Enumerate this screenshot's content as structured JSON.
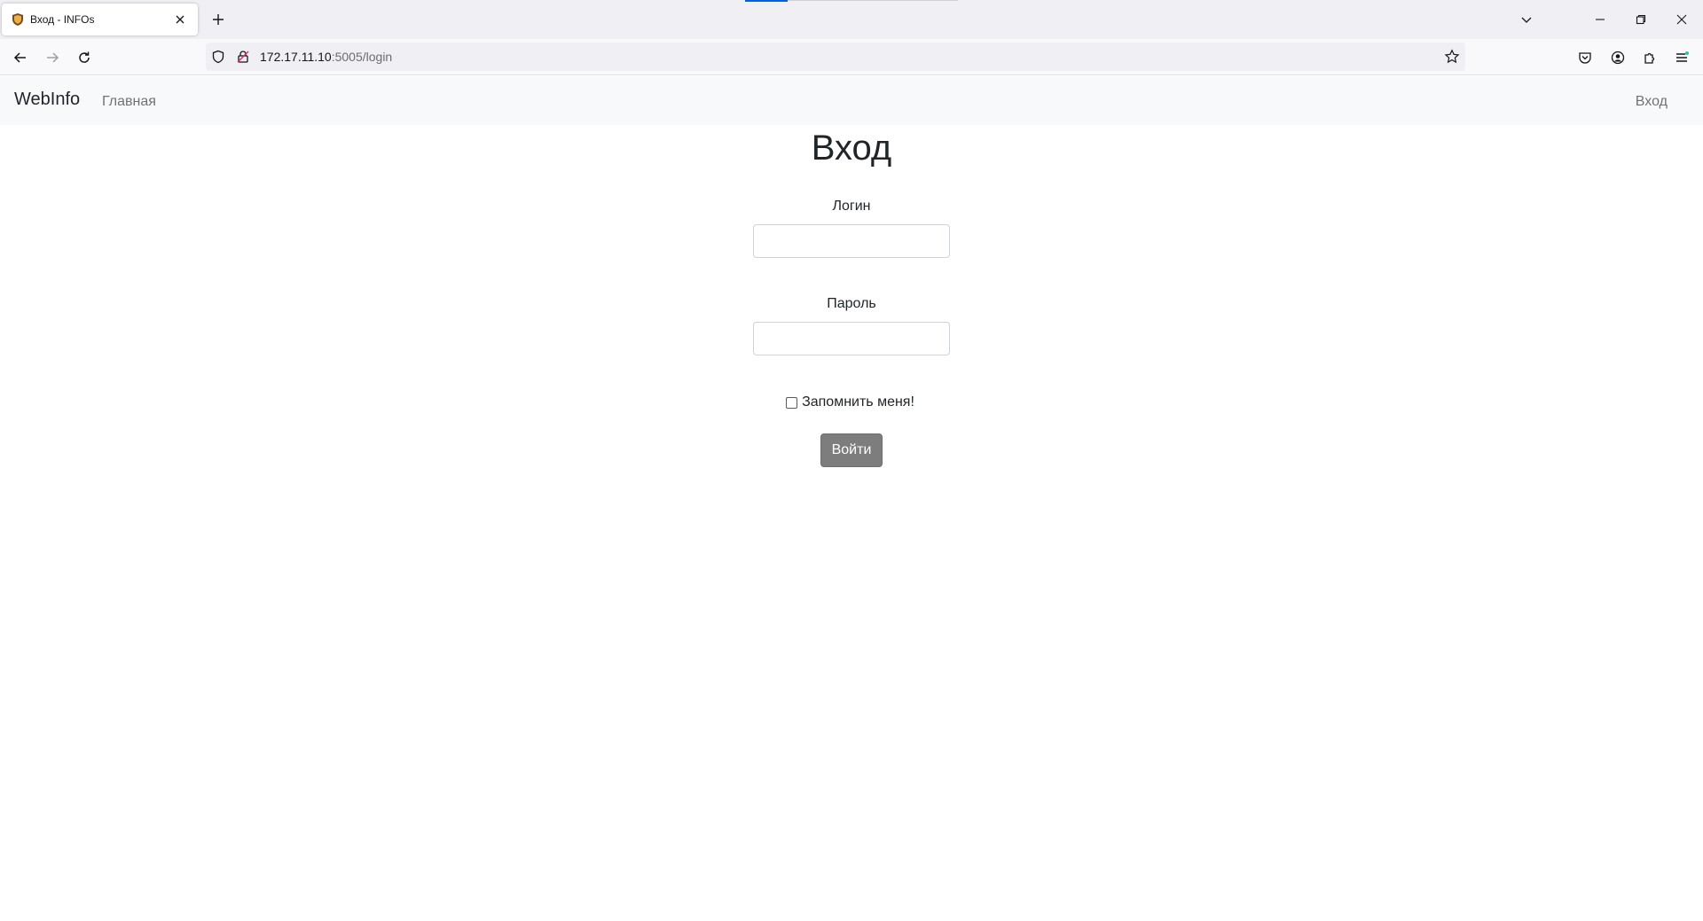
{
  "browser": {
    "tab_title": "Вход - INFOs",
    "url_host": "172.17.11.10",
    "url_rest": ":5005/login"
  },
  "site": {
    "brand": "WebInfo",
    "nav_home": "Главная",
    "nav_login": "Вход"
  },
  "login_form": {
    "title": "Вход",
    "username_label": "Логин",
    "username_value": "",
    "password_label": "Пароль",
    "password_value": "",
    "remember_label": "Запомнить меня!",
    "remember_checked": false,
    "submit_label": "Войти"
  },
  "colors": {
    "submit_bg": "#7d7d7d",
    "nav_bg": "#f8f9fa",
    "accent": "#0061e0"
  }
}
